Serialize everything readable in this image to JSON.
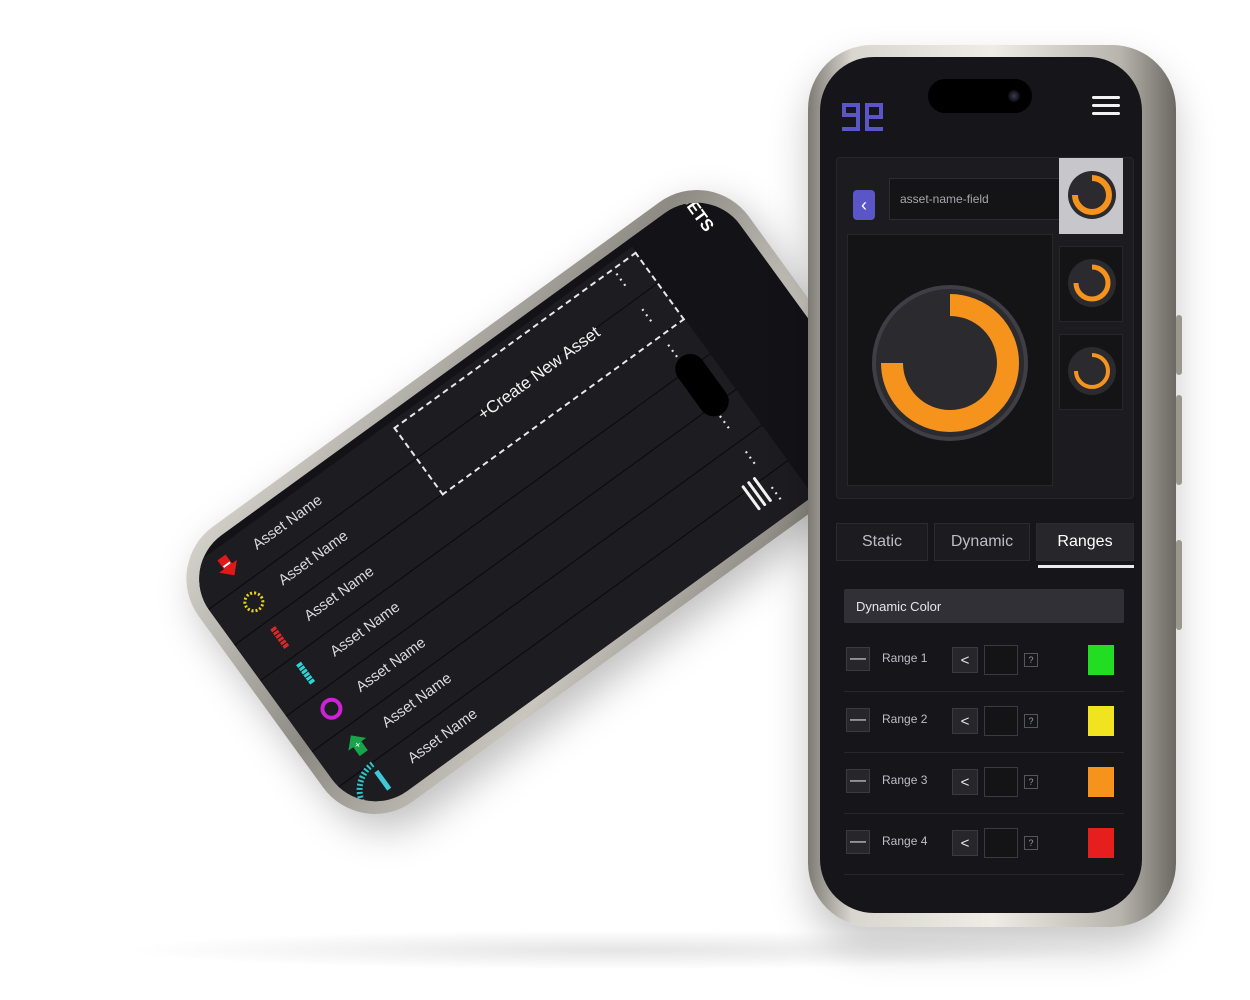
{
  "left_phone": {
    "title": "MY ASSETS",
    "create_label": "+Create New Asset",
    "assets": [
      {
        "name": "Asset Name",
        "icon": "cyan-bar-icon",
        "color": "#3fc8d8"
      },
      {
        "name": "Asset Name",
        "icon": "green-up-arrow-icon",
        "color": "#19a34a"
      },
      {
        "name": "Asset Name",
        "icon": "magenta-ring-icon",
        "color": "#d020d8"
      },
      {
        "name": "Asset Name",
        "icon": "cyan-striped-bar-icon",
        "color": "#2ed3d3"
      },
      {
        "name": "Asset Name",
        "icon": "red-striped-bar-icon",
        "color": "#d52a2a"
      },
      {
        "name": "Asset Name",
        "icon": "yellow-dotted-ring-icon",
        "color": "#e5d51c"
      },
      {
        "name": "Asset Name",
        "icon": "red-down-arrow-icon",
        "color": "#e01818"
      }
    ],
    "more_label": "..."
  },
  "right_phone": {
    "asset_name_value": "asset-name-field",
    "tabs": [
      {
        "label": "Static",
        "active": false
      },
      {
        "label": "Dynamic",
        "active": false
      },
      {
        "label": "Ranges",
        "active": true
      }
    ],
    "dynamic_color_label": "Dynamic Color",
    "lt_label": "<",
    "help_label": "?",
    "minus_label": "—",
    "ranges": [
      {
        "label": "Range 1",
        "color": "#22dd22"
      },
      {
        "label": "Range 2",
        "color": "#f2e321"
      },
      {
        "label": "Range 3",
        "color": "#f5931c"
      },
      {
        "label": "Range 4",
        "color": "#e61e1e"
      }
    ]
  },
  "colors": {
    "accent": "#5a56c8",
    "gauge": "#f5931c",
    "background": "#16161a"
  }
}
